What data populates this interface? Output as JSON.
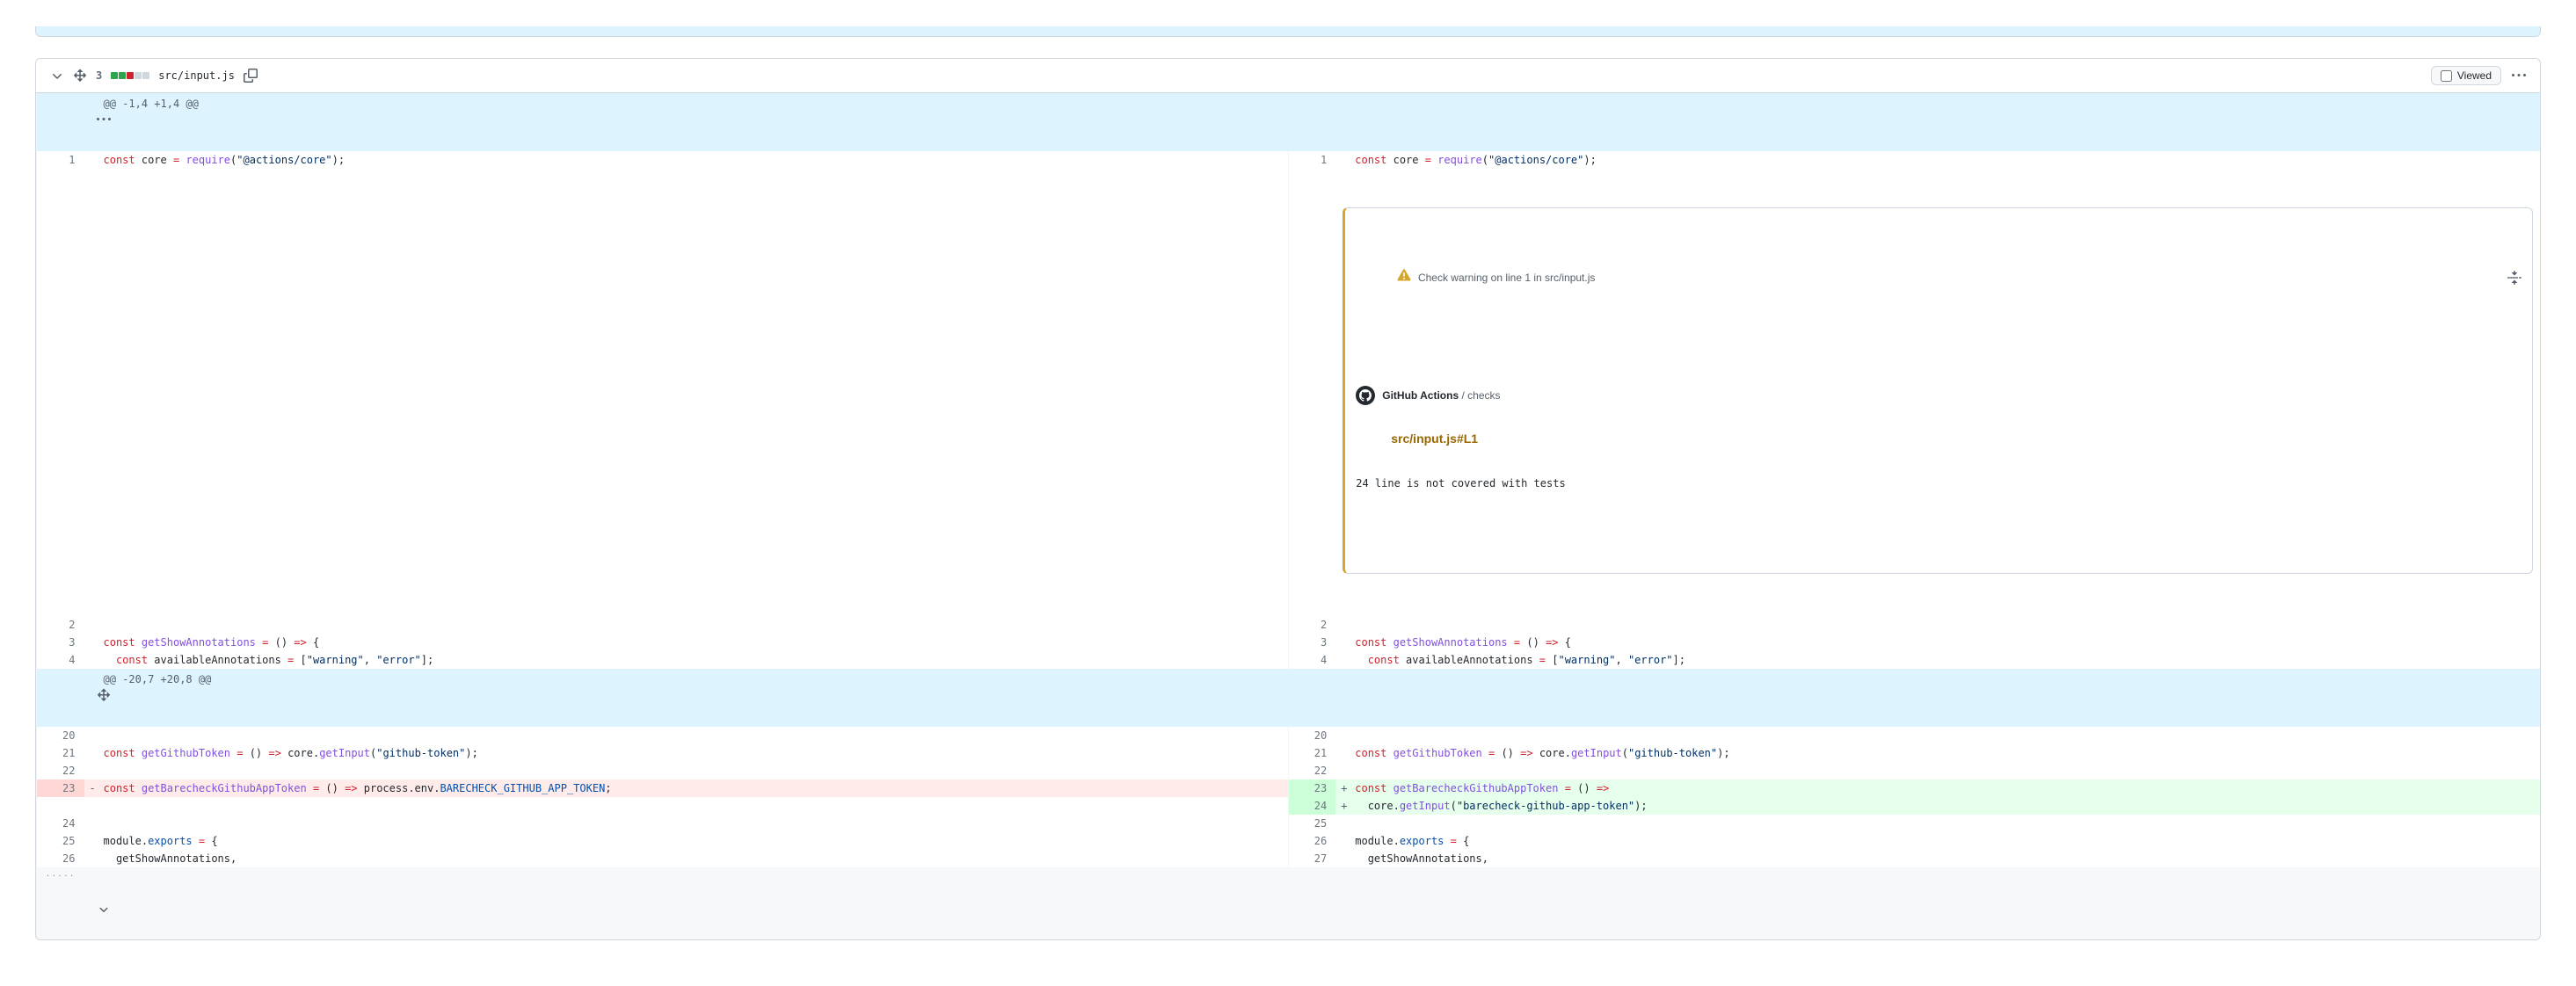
{
  "file": {
    "path": "src/input.js",
    "change_count": "3",
    "diffstat": {
      "add": 2,
      "del": 1,
      "neutral": 2
    },
    "viewed_label": "Viewed",
    "viewed_checked": false
  },
  "hunks": [
    {
      "header": "@@ -1,4 +1,4 @@"
    },
    {
      "header": "@@ -20,7 +20,8 @@"
    }
  ],
  "annotation": {
    "head": "Check warning on line 1 in src/input.js",
    "source_strong": "GitHub Actions",
    "source_suffix": " / checks",
    "link_text": "src/input.js#L1",
    "message": "24 line is not covered with tests"
  },
  "left_code": {
    "l1": "const core = require(\"@actions/core\");",
    "l2": "",
    "l3": "const getShowAnnotations = () => {",
    "l4": "  const availableAnnotations = [\"warning\", \"error\"];",
    "l20": "",
    "l21": "const getGithubToken = () => core.getInput(\"github-token\");",
    "l22": "",
    "l23": "const getBarecheckGithubAppToken = () => process.env.BARECHECK_GITHUB_APP_TOKEN;",
    "l24": "",
    "l25": "module.exports = {",
    "l26": "  getShowAnnotations,"
  },
  "right_code": {
    "r1": "const core = require(\"@actions/core\");",
    "r2": "",
    "r3": "const getShowAnnotations = () => {",
    "r4": "  const availableAnnotations = [\"warning\", \"error\"];",
    "r20": "",
    "r21": "const getGithubToken = () => core.getInput(\"github-token\");",
    "r22": "",
    "r23": "const getBarecheckGithubAppToken = () =>",
    "r24": "  core.getInput(\"barecheck-github-app-token\");",
    "r25": "",
    "r26": "module.exports = {",
    "r27": "  getShowAnnotations,"
  },
  "line_numbers": {
    "L": {
      "l1": "1",
      "l2": "2",
      "l3": "3",
      "l4": "4",
      "l20": "20",
      "l21": "21",
      "l22": "22",
      "l23": "23",
      "l24": "24",
      "l25": "25",
      "l26": "26"
    },
    "R": {
      "r1": "1",
      "r2": "2",
      "r3": "3",
      "r4": "4",
      "r20": "20",
      "r21": "21",
      "r22": "22",
      "r23": "23",
      "r24": "24",
      "r25": "25",
      "r26": "26",
      "r27": "27"
    }
  }
}
